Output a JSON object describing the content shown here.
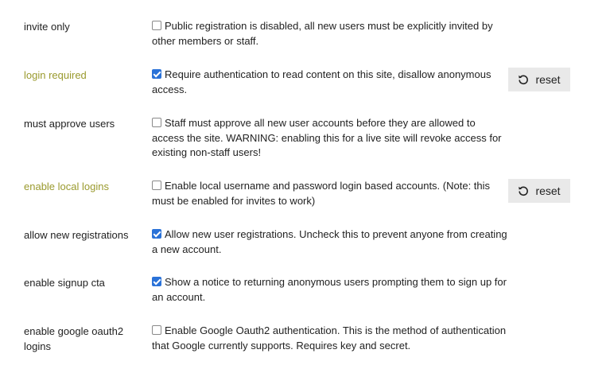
{
  "settings": [
    {
      "name": "invite only",
      "checked": false,
      "description": "Public registration is disabled, all new users must be explicitly invited by other members or staff.",
      "overridden": false
    },
    {
      "name": "login required",
      "checked": true,
      "description": "Require authentication to read content on this site, disallow anonymous access.",
      "overridden": true,
      "reset_label": "reset"
    },
    {
      "name": "must approve users",
      "checked": false,
      "description": "Staff must approve all new user accounts before they are allowed to access the site. WARNING: enabling this for a live site will revoke access for existing non-staff users!",
      "overridden": false
    },
    {
      "name": "enable local logins",
      "checked": false,
      "description": "Enable local username and password login based accounts. (Note: this must be enabled for invites to work)",
      "overridden": true,
      "reset_label": "reset"
    },
    {
      "name": "allow new registrations",
      "checked": true,
      "description": "Allow new user registrations. Uncheck this to prevent anyone from creating a new account.",
      "overridden": false
    },
    {
      "name": "enable signup cta",
      "checked": true,
      "description": "Show a notice to returning anonymous users prompting them to sign up for an account.",
      "overridden": false
    },
    {
      "name": "enable google oauth2 logins",
      "checked": false,
      "description": "Enable Google Oauth2 authentication. This is the method of authentication that Google currently supports. Requires key and secret.",
      "overridden": false
    }
  ],
  "colors": {
    "overridden_name": "#9a9a2e",
    "checkbox_checked": "#2a72d8",
    "reset_button_bg": "#e9e9e9"
  },
  "icons": {
    "reset": "undo-icon"
  }
}
